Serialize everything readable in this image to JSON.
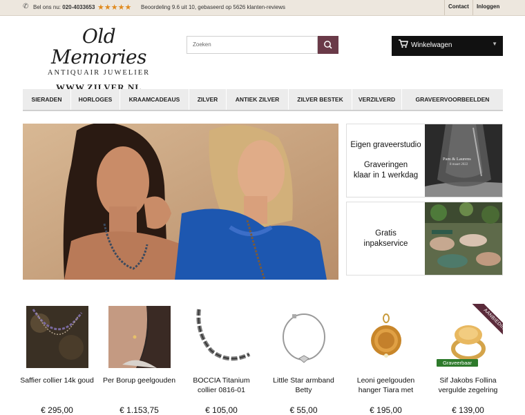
{
  "topbar": {
    "phone_label": "Bel ons nu:",
    "phone_number": "020-4033653",
    "stars": "★★★★★",
    "rating_text": "Beoordeling 9.6 uit 10, gebaseerd op 5626 klanten-reviews",
    "contact": "Contact",
    "login": "Inloggen"
  },
  "logo": {
    "line1": "Old Memories",
    "line2": "ANTIQUAIR JUWELIER",
    "line3": "WWW.ZILVER.NL"
  },
  "search": {
    "placeholder": "Zoeken"
  },
  "cart": {
    "label": "Winkelwagen"
  },
  "nav": [
    "SIERADEN",
    "HORLOGES",
    "KRAAMCADEAUS",
    "ZILVER",
    "ANTIEK ZILVER",
    "ZILVER BESTEK",
    "VERZILVERD",
    "GRAVEERVOORBEELDEN"
  ],
  "promos": [
    {
      "line1": "Eigen graveerstudio",
      "line2": "Graveringen",
      "line3": "klaar in 1 werkdag",
      "engraving1": "Pam & Laurens",
      "engraving2": "8 maart 2022"
    },
    {
      "line1": "Gratis",
      "line2": "inpakservice"
    }
  ],
  "products": [
    {
      "name": "Saffier collier 14k goud",
      "price": "€ 295,00"
    },
    {
      "name": "Per Borup geelgouden",
      "price": "€ 1.153,75"
    },
    {
      "name": "BOCCIA Titanium collier 0816-01",
      "price": "€ 105,00"
    },
    {
      "name": "Little Star armband Betty",
      "price": "€ 55,00"
    },
    {
      "name": "Leoni geelgouden hanger Tiara met",
      "price": "€ 195,00"
    },
    {
      "name": "Sif Jakobs Follina vergulde zegelring",
      "price": "€ 139,00"
    }
  ],
  "badges": {
    "graveerbaar": "Graveerbaar",
    "aanbieding": "AANBIEDING"
  },
  "colors": {
    "accent": "#6a3a48",
    "topbar_bg": "#ede7de",
    "star": "#e08a1e",
    "badge_green": "#2d7a2b"
  }
}
